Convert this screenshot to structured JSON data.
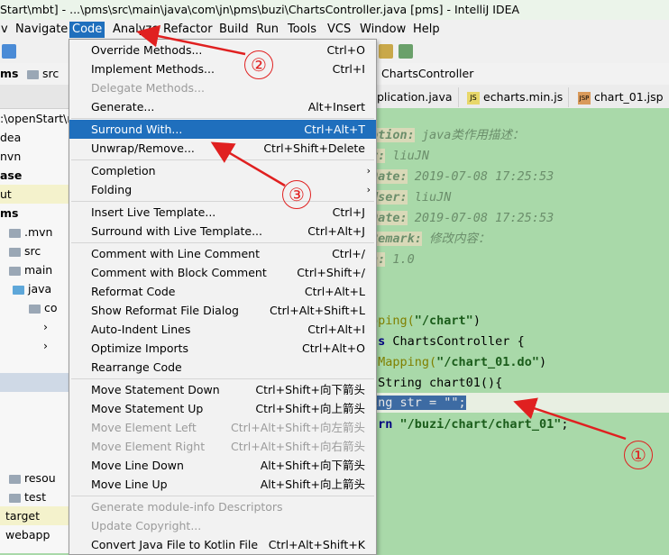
{
  "window_title": "Start\\mbt] - ...\\pms\\src\\main\\java\\com\\jn\\pms\\buzi\\ChartsController.java [pms] - IntelliJ IDEA",
  "menubar": [
    "v",
    "Navigate",
    "Code",
    "Analyze",
    "Refactor",
    "Build",
    "Run",
    "Tools",
    "VCS",
    "Window",
    "Help"
  ],
  "navbar": {
    "project": "ms",
    "src": "src",
    "controller": "ChartsController"
  },
  "tabs": [
    "plication.java",
    "echarts.min.js",
    "chart_01.jsp"
  ],
  "project_tree": [
    {
      "label": ":\\openStart\\r"
    },
    {
      "label": "dea"
    },
    {
      "label": "nvn"
    },
    {
      "label": "ase"
    },
    {
      "label": "ut"
    },
    {
      "label": "ms"
    },
    {
      "label": ".mvn"
    },
    {
      "label": "src"
    },
    {
      "label": "main"
    },
    {
      "label": "java"
    },
    {
      "label": "co"
    },
    {
      "label": "resou"
    },
    {
      "label": "test"
    },
    {
      "label": "target"
    },
    {
      "label": "webapp"
    }
  ],
  "code": {
    "l1_tag": "ption:",
    "l1_text": " java类作用描述：",
    "l2_tag": "r:",
    "l2_text": " liuJN",
    "l3_tag": "Date:",
    "l3_text": " 2019-07-08 17:25:53",
    "l4_tag": "User:",
    "l4_text": " liuJN",
    "l5_tag": "Date:",
    "l5_text": " 2019-07-08 17:25:53",
    "l6_tag": "Remark:",
    "l6_text": " 修改内容：",
    "l7_tag": "n:",
    "l7_text": " 1.0",
    "l8_a": "pping(",
    "l8_b": "\"/chart\"",
    "l8_c": ")",
    "l9_a": "ss",
    "l9_b": " ChartsController {",
    "l10_a": "tMapping(",
    "l10_b": "\"/chart_01.do\"",
    "l10_c": ")",
    "l11": " String chart01(){",
    "l12_sel": "ing str = \"\";",
    "l13_a": "urn ",
    "l13_b": "\"/buzi/chart/chart_01\"",
    "l13_c": ";"
  },
  "code_menu": {
    "items": [
      {
        "label": "Override Methods...",
        "shortcut": "Ctrl+O"
      },
      {
        "label": "Implement Methods...",
        "shortcut": "Ctrl+I"
      },
      {
        "label": "Delegate Methods...",
        "shortcut": ""
      },
      {
        "label": "Generate...",
        "shortcut": "Alt+Insert"
      },
      {
        "label": "Surround With...",
        "shortcut": "Ctrl+Alt+T"
      },
      {
        "label": "Unwrap/Remove...",
        "shortcut": "Ctrl+Shift+Delete"
      },
      {
        "label": "Completion",
        "shortcut": ""
      },
      {
        "label": "Folding",
        "shortcut": ""
      },
      {
        "label": "Insert Live Template...",
        "shortcut": "Ctrl+J"
      },
      {
        "label": "Surround with Live Template...",
        "shortcut": "Ctrl+Alt+J"
      },
      {
        "label": "Comment with Line Comment",
        "shortcut": "Ctrl+/"
      },
      {
        "label": "Comment with Block Comment",
        "shortcut": "Ctrl+Shift+/"
      },
      {
        "label": "Reformat Code",
        "shortcut": "Ctrl+Alt+L"
      },
      {
        "label": "Show Reformat File Dialog",
        "shortcut": "Ctrl+Alt+Shift+L"
      },
      {
        "label": "Auto-Indent Lines",
        "shortcut": "Ctrl+Alt+I"
      },
      {
        "label": "Optimize Imports",
        "shortcut": "Ctrl+Alt+O"
      },
      {
        "label": "Rearrange Code",
        "shortcut": ""
      },
      {
        "label": "Move Statement Down",
        "shortcut": "Ctrl+Shift+向下箭头"
      },
      {
        "label": "Move Statement Up",
        "shortcut": "Ctrl+Shift+向上箭头"
      },
      {
        "label": "Move Element Left",
        "shortcut": "Ctrl+Alt+Shift+向左箭头"
      },
      {
        "label": "Move Element Right",
        "shortcut": "Ctrl+Alt+Shift+向右箭头"
      },
      {
        "label": "Move Line Down",
        "shortcut": "Alt+Shift+向下箭头"
      },
      {
        "label": "Move Line Up",
        "shortcut": "Alt+Shift+向上箭头"
      },
      {
        "label": "Generate module-info Descriptors",
        "shortcut": ""
      },
      {
        "label": "Update Copyright...",
        "shortcut": ""
      },
      {
        "label": "Convert Java File to Kotlin File",
        "shortcut": "Ctrl+Alt+Shift+K"
      }
    ]
  },
  "annotations": {
    "one": "①",
    "two": "②",
    "three": "③"
  },
  "colors": {
    "editor_bg": "#a9d9a9",
    "menu_highlight": "#1f6fbd",
    "annotation_red": "#e02020"
  }
}
